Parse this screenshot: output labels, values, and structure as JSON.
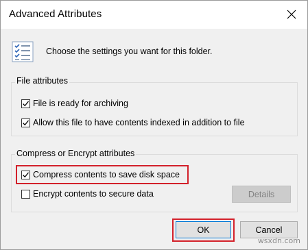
{
  "dialog": {
    "title": "Advanced Attributes",
    "header_text": "Choose the settings you want for this folder."
  },
  "file_attributes": {
    "label": "File attributes",
    "items": [
      {
        "label": "File is ready for archiving",
        "checked": true
      },
      {
        "label": "Allow this file to have contents indexed in addition to file",
        "checked": true
      }
    ]
  },
  "compress_encrypt": {
    "label": "Compress or Encrypt attributes",
    "items": [
      {
        "label": "Compress contents to save disk space",
        "checked": true,
        "highlighted": true
      },
      {
        "label": "Encrypt contents to secure data",
        "checked": false
      }
    ],
    "details_label": "Details"
  },
  "buttons": {
    "ok": "OK",
    "cancel": "Cancel"
  },
  "watermark": "wsxdn.com",
  "colors": {
    "highlight": "#d3202a",
    "accent": "#0078d7"
  }
}
